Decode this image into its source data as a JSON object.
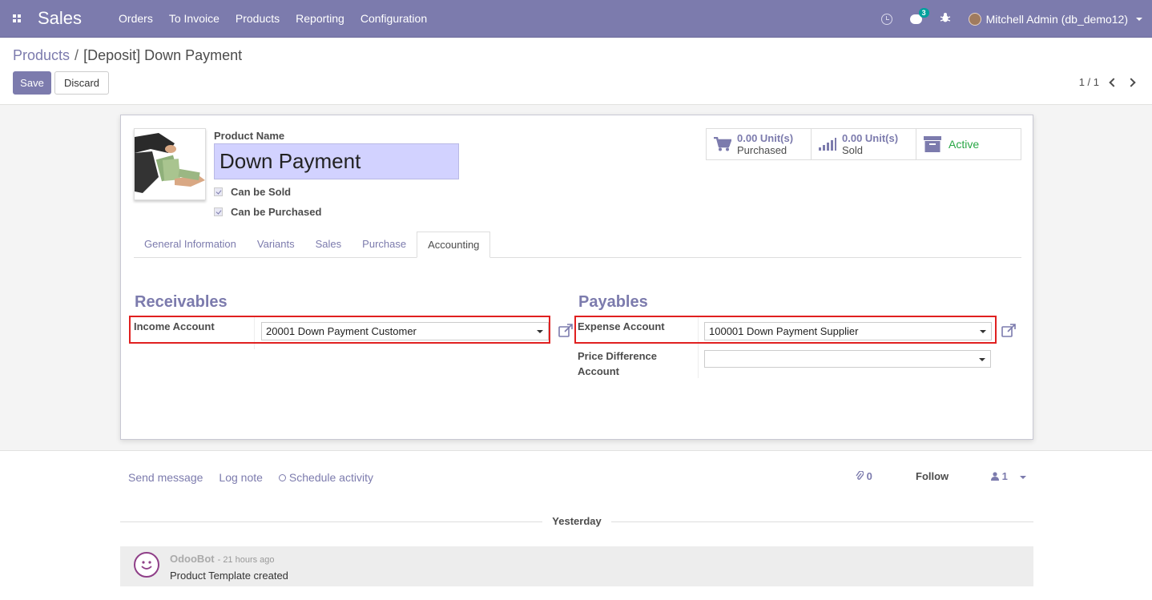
{
  "navbar": {
    "app_name": "Sales",
    "menu": [
      "Orders",
      "To Invoice",
      "Products",
      "Reporting",
      "Configuration"
    ],
    "chat_count": "3",
    "user": "Mitchell Admin (db_demo12)"
  },
  "breadcrumb": {
    "parent": "Products",
    "current": "[Deposit] Down Payment"
  },
  "buttons": {
    "save": "Save",
    "discard": "Discard"
  },
  "pager": "1 / 1",
  "product": {
    "name_label": "Product Name",
    "name": "Down Payment",
    "can_be_sold": "Can be Sold",
    "can_be_purchased": "Can be Purchased"
  },
  "stats": {
    "purchased_value": "0.00 Unit(s)",
    "purchased_label": "Purchased",
    "sold_value": "0.00 Unit(s)",
    "sold_label": "Sold",
    "active_label": "Active"
  },
  "tabs": [
    "General Information",
    "Variants",
    "Sales",
    "Purchase",
    "Accounting"
  ],
  "accounting": {
    "receivables_title": "Receivables",
    "income_label": "Income Account",
    "income_value": "20001 Down Payment Customer",
    "payables_title": "Payables",
    "expense_label": "Expense Account",
    "expense_value": "100001 Down Payment Supplier",
    "price_diff_label_1": "Price Difference",
    "price_diff_label_2": "Account",
    "price_diff_value": ""
  },
  "chatter": {
    "send_message": "Send message",
    "log_note": "Log note",
    "schedule_activity": "Schedule activity",
    "attachments": "0",
    "follow": "Follow",
    "followers": "1",
    "day": "Yesterday",
    "author": "OdooBot",
    "time": "- 21 hours ago",
    "body": "Product Template created"
  },
  "colors": {
    "brand": "#7c7bad",
    "active": "#28a745",
    "highlight": "#e02020"
  }
}
